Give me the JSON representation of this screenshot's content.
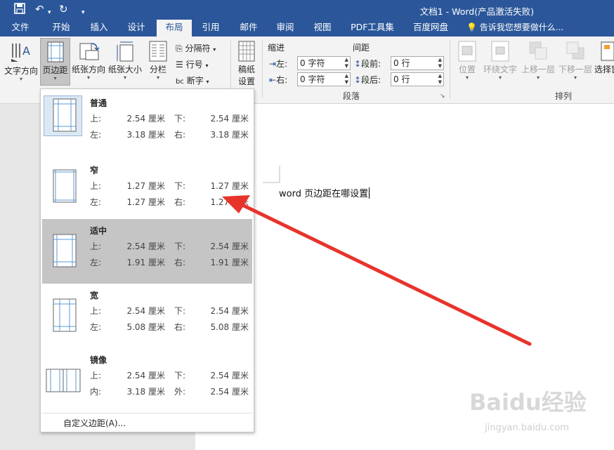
{
  "window": {
    "title": "文档1 - Word(产品激活失败)"
  },
  "tabs": [
    "文件",
    "开始",
    "插入",
    "设计",
    "布局",
    "引用",
    "邮件",
    "审阅",
    "视图",
    "PDF工具集",
    "百度网盘"
  ],
  "active_tab": "布局",
  "tell_me": "告诉我您想要做什么...",
  "ribbon": {
    "text_direction": "文字方向",
    "margins": "页边距",
    "orientation": "纸张方向",
    "size": "纸张大小",
    "columns": "分栏",
    "breaks": "分隔符",
    "line_numbers": "行号",
    "hyphenation": "断字",
    "draft_paper": "稿纸\n设置",
    "draft_line1": "稿纸",
    "draft_line2": "设置",
    "indent_title": "缩进",
    "spacing_title": "间距",
    "indent_left_label": "左:",
    "indent_left_value": "0 字符",
    "indent_right_label": "右:",
    "indent_right_value": "0 字符",
    "space_before_label": "段前:",
    "space_before_value": "0 行",
    "space_after_label": "段后:",
    "space_after_value": "0 行",
    "paragraph_group": "段落",
    "position": "位置",
    "wrap_text": "环绕文字",
    "bring_forward": "上移一层",
    "send_backward": "下移一层",
    "select": "选择窗",
    "arrange_group": "排列"
  },
  "margins_menu": {
    "presets": [
      {
        "name": "普通",
        "l1a": "上:",
        "v1a": "2.54 厘米",
        "l1b": "下:",
        "v1b": "2.54 厘米",
        "l2a": "左:",
        "v2a": "3.18 厘米",
        "l2b": "右:",
        "v2b": "3.18 厘米"
      },
      {
        "name": "窄",
        "l1a": "上:",
        "v1a": "1.27 厘米",
        "l1b": "下:",
        "v1b": "1.27 厘米",
        "l2a": "左:",
        "v2a": "1.27 厘米",
        "l2b": "右:",
        "v2b": "1.27 厘米"
      },
      {
        "name": "适中",
        "l1a": "上:",
        "v1a": "2.54 厘米",
        "l1b": "下:",
        "v1b": "2.54 厘米",
        "l2a": "左:",
        "v2a": "1.91 厘米",
        "l2b": "右:",
        "v2b": "1.91 厘米"
      },
      {
        "name": "宽",
        "l1a": "上:",
        "v1a": "2.54 厘米",
        "l1b": "下:",
        "v1b": "2.54 厘米",
        "l2a": "左:",
        "v2a": "5.08 厘米",
        "l2b": "右:",
        "v2b": "5.08 厘米"
      },
      {
        "name": "镜像",
        "l1a": "上:",
        "v1a": "2.54 厘米",
        "l1b": "下:",
        "v1b": "2.54 厘米",
        "l2a": "内:",
        "v2a": "3.18 厘米",
        "l2b": "外:",
        "v2b": "2.54 厘米"
      }
    ],
    "custom": "自定义边距(A)..."
  },
  "document": {
    "text": "word 页边距在哪设置"
  },
  "watermark": {
    "main": "Baidu经验",
    "sub": "jingyan.baidu.com"
  },
  "colors": {
    "word_blue": "#2b579a",
    "arrow_red": "#e8332b",
    "hover_grey": "#c5c5c5"
  }
}
